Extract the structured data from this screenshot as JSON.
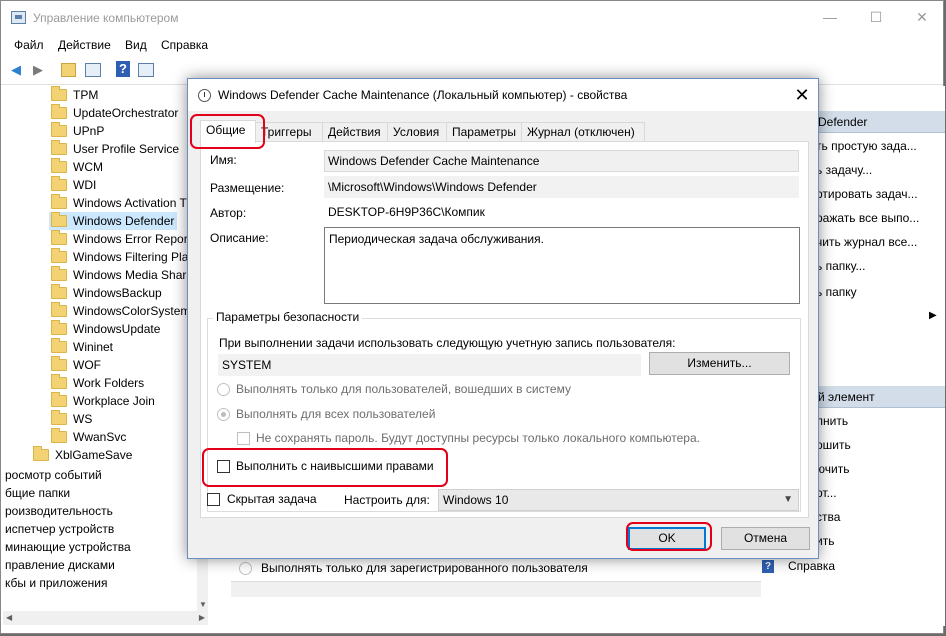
{
  "window": {
    "title": "Управление компьютером",
    "minimize": "—",
    "maximize": "☐",
    "close": "✕"
  },
  "menu": [
    "Файл",
    "Действие",
    "Вид",
    "Справка"
  ],
  "toolbar": {
    "back": "◀",
    "forward": "▶",
    "help": "?"
  },
  "tree": {
    "items": [
      "TPM",
      "UpdateOrchestrator",
      "UPnP",
      "User Profile Service",
      "WCM",
      "WDI",
      "Windows Activation T",
      "Windows Defender",
      "Windows Error Report",
      "Windows Filtering Pla",
      "Windows Media Shari",
      "WindowsBackup",
      "WindowsColorSystem",
      "WindowsUpdate",
      "Wininet",
      "WOF",
      "Work Folders",
      "Workplace Join",
      "WS",
      "WwanSvc"
    ],
    "selected": "Windows Defender",
    "parent_item": "XblGameSave",
    "root_items": [
      "росмотр событий",
      "бщие папки",
      "роизводительность",
      "испетчер устройств",
      "минающие устройства",
      "правление дисками",
      "кбы и приложения"
    ]
  },
  "actions": {
    "header1": "Defender",
    "items1": [
      "ть простую зада...",
      "ь задачу...",
      "ртировать задач...",
      "ражать все выпо...",
      "чить журнал все...",
      "ь папку...",
      "ь папку"
    ],
    "header2": "й элемент",
    "items2": [
      "лнить",
      "ршить",
      "ючить",
      "рт...",
      "ства",
      "ить"
    ],
    "help": "Справка"
  },
  "behind_list": {
    "radio_text": "Выполнять только для зарегистрированного пользователя"
  },
  "dialog": {
    "title": "Windows Defender Cache Maintenance (Локальный компьютер) - свойства",
    "close": "✕",
    "tabs": [
      "Общие",
      "Триггеры",
      "Действия",
      "Условия",
      "Параметры",
      "Журнал (отключен)"
    ],
    "name_label": "Имя:",
    "name_value": "Windows Defender Cache Maintenance",
    "location_label": "Размещение:",
    "location_value": "\\Microsoft\\Windows\\Windows Defender",
    "author_label": "Автор:",
    "author_value": "DESKTOP-6H9P36C\\Компик",
    "desc_label": "Описание:",
    "desc_value": "Периодическая задача обслуживания.",
    "security": {
      "title": "Параметры безопасности",
      "account_prompt": "При выполнении задачи использовать следующую учетную запись пользователя:",
      "account_value": "SYSTEM",
      "change_button": "Изменить...",
      "radio_logged_on": "Выполнять только для пользователей, вошедших в систему",
      "radio_all_users": "Выполнять для всех пользователей",
      "no_save_password": "Не сохранять пароль. Будут доступны ресурсы только локального компьютера.",
      "highest_privileges": "Выполнить с наивысшими правами"
    },
    "hidden_task": "Скрытая задача",
    "configure_label": "Настроить для:",
    "configure_value": "Windows 10",
    "ok": "OK",
    "cancel": "Отмена"
  },
  "colors": {
    "highlight": "#e2001a",
    "selection": "#cce8ff",
    "accent": "#0078d7"
  }
}
